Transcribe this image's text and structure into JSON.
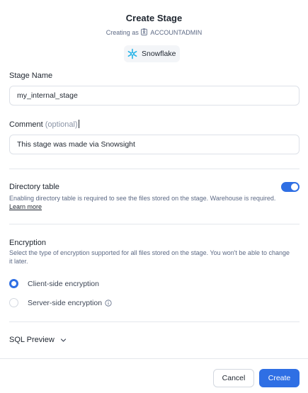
{
  "header": {
    "title": "Create Stage",
    "creating_as_prefix": "Creating as",
    "role": "ACCOUNTADMIN",
    "role_icon": "id-badge-icon"
  },
  "account": {
    "label": "Snowflake",
    "icon": "snowflake-icon"
  },
  "stage_name": {
    "label": "Stage Name",
    "value": "my_internal_stage"
  },
  "comment": {
    "label": "Comment",
    "optional": "(optional)",
    "value": "This stage was made via Snowsight"
  },
  "directory_table": {
    "title": "Directory table",
    "help": "Enabling directory table is required to see the files stored on the stage. Warehouse is required.",
    "learn_more": "Learn more",
    "enabled": true
  },
  "encryption": {
    "title": "Encryption",
    "help": "Select the type of encryption supported for all files stored on the stage. You won't be able to change it later.",
    "options": [
      {
        "label": "Client-side encryption",
        "selected": true
      },
      {
        "label": "Server-side encryption",
        "selected": false,
        "info_icon": "info-icon"
      }
    ]
  },
  "sql_preview": {
    "label": "SQL Preview",
    "expanded": false
  },
  "footer": {
    "cancel_label": "Cancel",
    "create_label": "Create"
  },
  "colors": {
    "accent": "#2f6fe4",
    "snowflake": "#29b5e8",
    "text": "#1e252f",
    "muted": "#5d6a85"
  }
}
